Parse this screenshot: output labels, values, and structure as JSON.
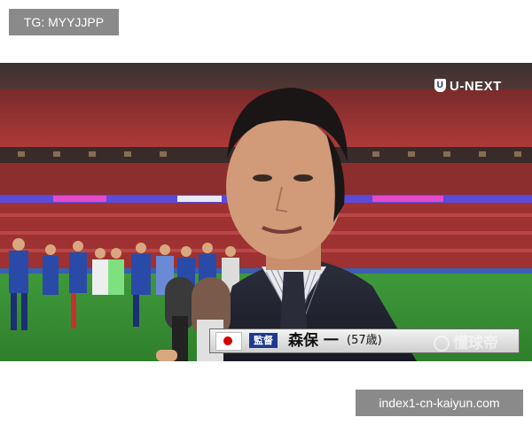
{
  "watermark_top": "TG: MYYJJPP",
  "watermark_bottom": "index1-cn-kaiyun.com",
  "broadcaster_logo": "U-NEXT",
  "lower_third": {
    "role": "監督",
    "name": "森保 一",
    "age": "(57歳)"
  },
  "corner_watermark": "懂球帝"
}
